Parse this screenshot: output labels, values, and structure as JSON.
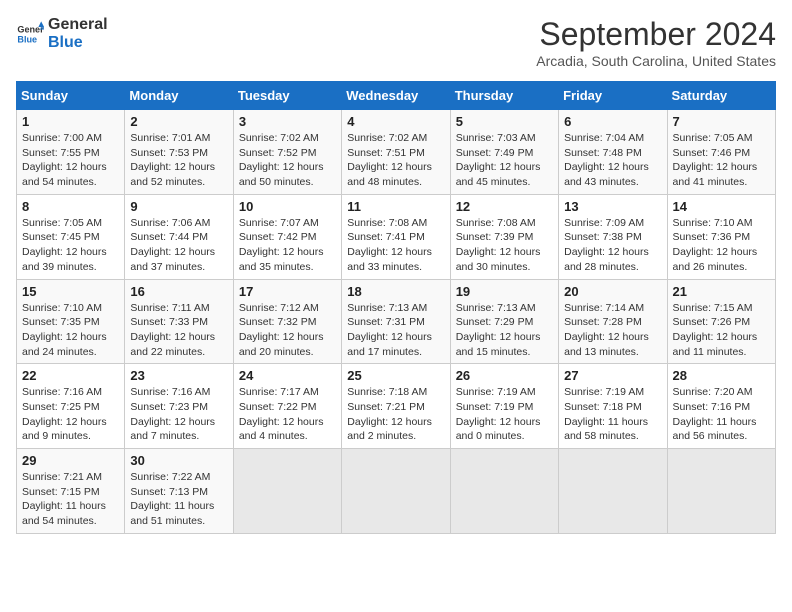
{
  "header": {
    "logo_line1": "General",
    "logo_line2": "Blue",
    "month_title": "September 2024",
    "subtitle": "Arcadia, South Carolina, United States"
  },
  "columns": [
    "Sunday",
    "Monday",
    "Tuesday",
    "Wednesday",
    "Thursday",
    "Friday",
    "Saturday"
  ],
  "weeks": [
    [
      {
        "day": "1",
        "info": "Sunrise: 7:00 AM\nSunset: 7:55 PM\nDaylight: 12 hours\nand 54 minutes."
      },
      {
        "day": "2",
        "info": "Sunrise: 7:01 AM\nSunset: 7:53 PM\nDaylight: 12 hours\nand 52 minutes."
      },
      {
        "day": "3",
        "info": "Sunrise: 7:02 AM\nSunset: 7:52 PM\nDaylight: 12 hours\nand 50 minutes."
      },
      {
        "day": "4",
        "info": "Sunrise: 7:02 AM\nSunset: 7:51 PM\nDaylight: 12 hours\nand 48 minutes."
      },
      {
        "day": "5",
        "info": "Sunrise: 7:03 AM\nSunset: 7:49 PM\nDaylight: 12 hours\nand 45 minutes."
      },
      {
        "day": "6",
        "info": "Sunrise: 7:04 AM\nSunset: 7:48 PM\nDaylight: 12 hours\nand 43 minutes."
      },
      {
        "day": "7",
        "info": "Sunrise: 7:05 AM\nSunset: 7:46 PM\nDaylight: 12 hours\nand 41 minutes."
      }
    ],
    [
      {
        "day": "8",
        "info": "Sunrise: 7:05 AM\nSunset: 7:45 PM\nDaylight: 12 hours\nand 39 minutes."
      },
      {
        "day": "9",
        "info": "Sunrise: 7:06 AM\nSunset: 7:44 PM\nDaylight: 12 hours\nand 37 minutes."
      },
      {
        "day": "10",
        "info": "Sunrise: 7:07 AM\nSunset: 7:42 PM\nDaylight: 12 hours\nand 35 minutes."
      },
      {
        "day": "11",
        "info": "Sunrise: 7:08 AM\nSunset: 7:41 PM\nDaylight: 12 hours\nand 33 minutes."
      },
      {
        "day": "12",
        "info": "Sunrise: 7:08 AM\nSunset: 7:39 PM\nDaylight: 12 hours\nand 30 minutes."
      },
      {
        "day": "13",
        "info": "Sunrise: 7:09 AM\nSunset: 7:38 PM\nDaylight: 12 hours\nand 28 minutes."
      },
      {
        "day": "14",
        "info": "Sunrise: 7:10 AM\nSunset: 7:36 PM\nDaylight: 12 hours\nand 26 minutes."
      }
    ],
    [
      {
        "day": "15",
        "info": "Sunrise: 7:10 AM\nSunset: 7:35 PM\nDaylight: 12 hours\nand 24 minutes."
      },
      {
        "day": "16",
        "info": "Sunrise: 7:11 AM\nSunset: 7:33 PM\nDaylight: 12 hours\nand 22 minutes."
      },
      {
        "day": "17",
        "info": "Sunrise: 7:12 AM\nSunset: 7:32 PM\nDaylight: 12 hours\nand 20 minutes."
      },
      {
        "day": "18",
        "info": "Sunrise: 7:13 AM\nSunset: 7:31 PM\nDaylight: 12 hours\nand 17 minutes."
      },
      {
        "day": "19",
        "info": "Sunrise: 7:13 AM\nSunset: 7:29 PM\nDaylight: 12 hours\nand 15 minutes."
      },
      {
        "day": "20",
        "info": "Sunrise: 7:14 AM\nSunset: 7:28 PM\nDaylight: 12 hours\nand 13 minutes."
      },
      {
        "day": "21",
        "info": "Sunrise: 7:15 AM\nSunset: 7:26 PM\nDaylight: 12 hours\nand 11 minutes."
      }
    ],
    [
      {
        "day": "22",
        "info": "Sunrise: 7:16 AM\nSunset: 7:25 PM\nDaylight: 12 hours\nand 9 minutes."
      },
      {
        "day": "23",
        "info": "Sunrise: 7:16 AM\nSunset: 7:23 PM\nDaylight: 12 hours\nand 7 minutes."
      },
      {
        "day": "24",
        "info": "Sunrise: 7:17 AM\nSunset: 7:22 PM\nDaylight: 12 hours\nand 4 minutes."
      },
      {
        "day": "25",
        "info": "Sunrise: 7:18 AM\nSunset: 7:21 PM\nDaylight: 12 hours\nand 2 minutes."
      },
      {
        "day": "26",
        "info": "Sunrise: 7:19 AM\nSunset: 7:19 PM\nDaylight: 12 hours\nand 0 minutes."
      },
      {
        "day": "27",
        "info": "Sunrise: 7:19 AM\nSunset: 7:18 PM\nDaylight: 11 hours\nand 58 minutes."
      },
      {
        "day": "28",
        "info": "Sunrise: 7:20 AM\nSunset: 7:16 PM\nDaylight: 11 hours\nand 56 minutes."
      }
    ],
    [
      {
        "day": "29",
        "info": "Sunrise: 7:21 AM\nSunset: 7:15 PM\nDaylight: 11 hours\nand 54 minutes."
      },
      {
        "day": "30",
        "info": "Sunrise: 7:22 AM\nSunset: 7:13 PM\nDaylight: 11 hours\nand 51 minutes."
      },
      {
        "day": "",
        "info": ""
      },
      {
        "day": "",
        "info": ""
      },
      {
        "day": "",
        "info": ""
      },
      {
        "day": "",
        "info": ""
      },
      {
        "day": "",
        "info": ""
      }
    ]
  ]
}
